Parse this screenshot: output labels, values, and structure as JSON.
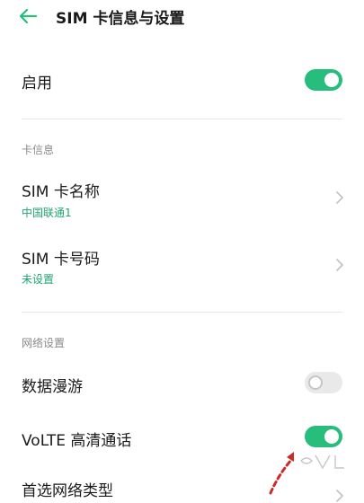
{
  "header": {
    "title": "SIM 卡信息与设置",
    "back_icon": "back-arrow-icon"
  },
  "enable": {
    "label": "启用",
    "state": "on"
  },
  "card_info": {
    "section_title": "卡信息",
    "name": {
      "label": "SIM 卡名称",
      "value": "中国联通1"
    },
    "number": {
      "label": "SIM 卡号码",
      "value": "未设置"
    }
  },
  "network": {
    "section_title": "网络设置",
    "roaming": {
      "label": "数据漫游",
      "state": "off"
    },
    "volte": {
      "label": "VoLTE 高清通话",
      "state": "on"
    },
    "preferred": {
      "label": "首选网络类型"
    }
  },
  "colors": {
    "accent": "#27bd7d",
    "value_text": "#1fa572",
    "section_text": "#8a8a8a",
    "toggle_off": "#e9e9e9"
  }
}
